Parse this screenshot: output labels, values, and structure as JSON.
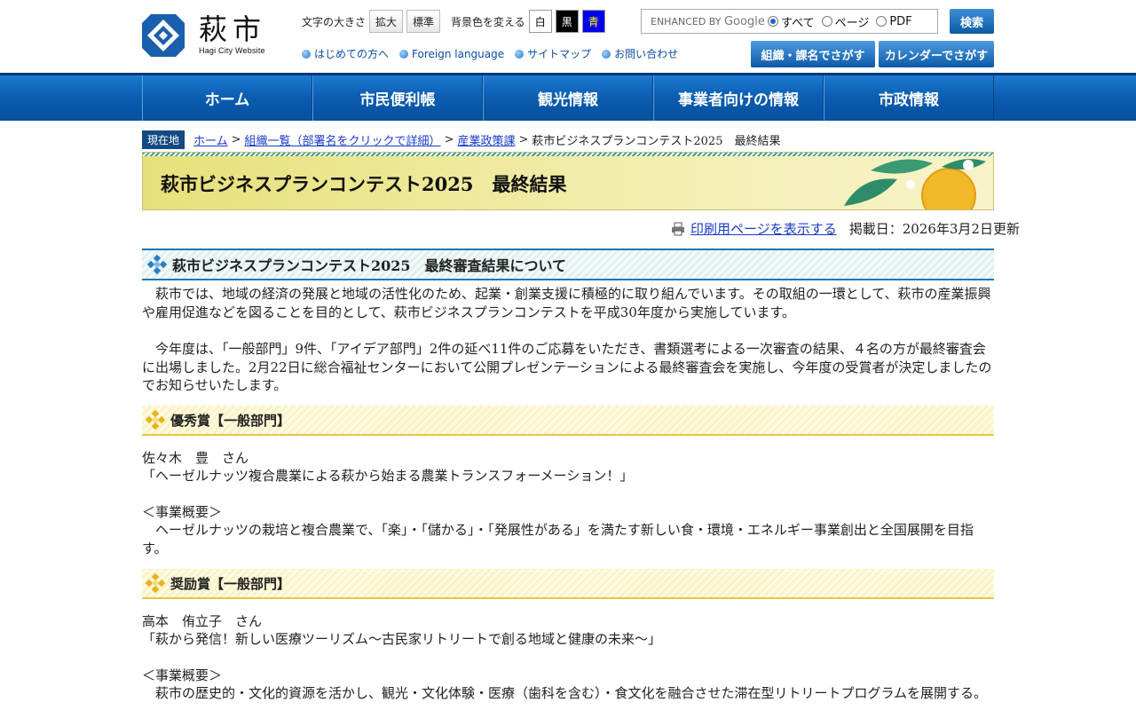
{
  "header": {
    "logo_kanji": "萩市",
    "logo_en": "Hagi City Website",
    "font_size_label": "文字の大きさ",
    "font_enlarge": "拡大",
    "font_standard": "標準",
    "bg_label": "背景色を変える",
    "bg_white": "白",
    "bg_black": "黒",
    "bg_blue": "青",
    "search_brand": "ENHANCED BY",
    "search_google": "Google",
    "radio_all": "すべて",
    "radio_page": "ページ",
    "radio_pdf": "PDF",
    "search_button": "検索",
    "org_button": "組織・課名でさがす",
    "calendar_button": "カレンダーでさがす",
    "links": [
      "はじめての方へ",
      "Foreign language",
      "サイトマップ",
      "お問い合わせ"
    ]
  },
  "nav": [
    "ホーム",
    "市民便利帳",
    "観光情報",
    "事業者向けの情報",
    "市政情報"
  ],
  "breadcrumb": {
    "here": "現在地",
    "items": [
      "ホーム",
      "組織一覧（部署名をクリックで詳細）",
      "産業政策課"
    ],
    "current": "萩市ビジネスプランコンテスト2025　最終結果"
  },
  "page_title": "萩市ビジネスプランコンテスト2025　最終結果",
  "print_link": "印刷用ページを表示する",
  "updated": "掲載日：2026年3月2日更新",
  "section1": {
    "title": "萩市ビジネスプランコンテスト2025　最終審査結果について",
    "para1": "　萩市では、地域の経済の発展と地域の活性化のため、起業・創業支援に積極的に取り組んでいます。その取組の一環として、萩市の産業振興や雇用促進などを図ることを目的として、萩市ビジネスプランコンテストを平成30年度から実施しています。",
    "para2": "　今年度は、「一般部門」9件、「アイデア部門」2件の延べ11件のご応募をいただき、書類選考による一次審査の結果、４名の方が最終審査会に出場しました。2月22日に総合福祉センターにおいて公開プレゼンテーションによる最終審査会を実施し、今年度の受賞者が決定しましたのでお知らせいたします。"
  },
  "awards": [
    {
      "title": "優秀賞【一般部門】",
      "name": "佐々木　豊　さん",
      "plan": "「ヘーゼルナッツ複合農業による萩から始まる農業トランスフォーメーション！」",
      "summary_label": "＜事業概要＞",
      "summary": "　ヘーゼルナッツの栽培と複合農業で、「楽」・「儲かる」・「発展性がある」を満たす新しい食・環境・エネルギー事業創出と全国展開を目指す。"
    },
    {
      "title": "奨励賞【一般部門】",
      "name": "高本　侑立子　さん",
      "plan": "「萩から発信！新しい医療ツーリズム〜古民家リトリートで創る地域と健康の未来〜」",
      "summary_label": "＜事業概要＞",
      "summary": "　萩市の歴史的・文化的資源を活かし、観光・文化体験・医療（歯科を含む）・食文化を融合させた滞在型リトリートプログラムを展開する。"
    }
  ]
}
